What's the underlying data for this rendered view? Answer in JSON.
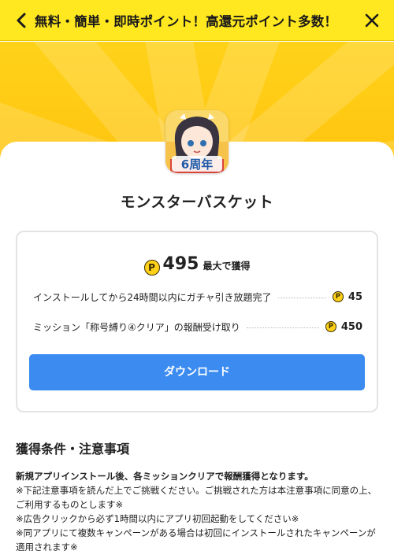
{
  "header": {
    "title": "無料・簡単・即時ポイント！高還元ポイント多数！"
  },
  "app": {
    "name": "モンスターバスケット",
    "icon_text": "6周年"
  },
  "reward": {
    "coin_symbol": "P",
    "total": "495",
    "total_suffix": "最大で獲得",
    "missions": [
      {
        "label": "インストールしてから24時間以内にガチャ引き放題完了",
        "points": "45"
      },
      {
        "label": "ミッション「称号縛り④クリア」の報酬受け取り",
        "points": "450"
      }
    ],
    "download_label": "ダウンロード"
  },
  "notes": {
    "title": "獲得条件・注意事項",
    "lead": "新規アプリインストール後、各ミッションクリアで報酬獲得となります。",
    "lines": [
      "※下記注意事項を読んだ上でご挑戦ください。ご挑戦された方は本注意事項に同意の上、ご利用するものとします※",
      "※広告クリックから必ず1時間以内にアプリ初回起動をしてください※",
      "※同アプリにて複数キャンペーンがある場合は初回にインストールされたキャンペーンが適用されます※"
    ]
  },
  "colors": {
    "header_bg": "#ffe81f",
    "banner_bg": "#ffc20e",
    "button_bg": "#3b8bf0",
    "coin": "#ffd21a"
  }
}
